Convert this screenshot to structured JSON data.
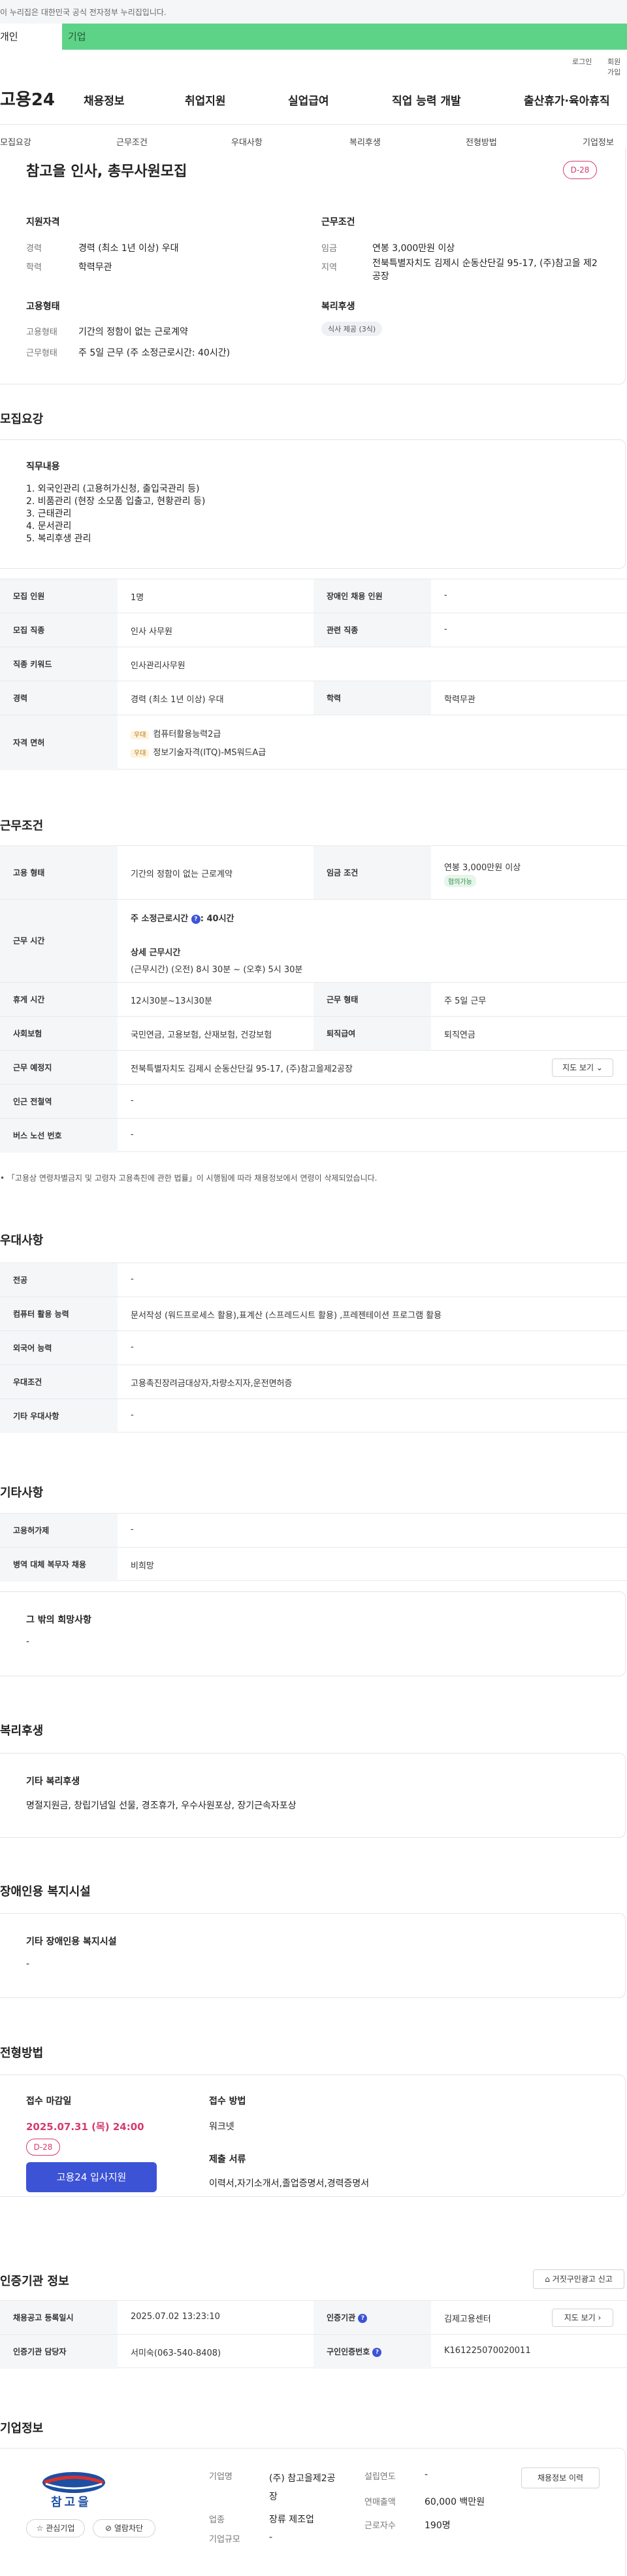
{
  "banner": "이 누리집은 대한민국 공식 전자정부 누리집입니다.",
  "tabs": {
    "individual": "개인",
    "corporate": "기업"
  },
  "util": {
    "login": "로그인",
    "signup": "회원가입"
  },
  "logo": "고용24",
  "nav": [
    "채용정보",
    "취업지원",
    "실업급여",
    "직업 능력 개발",
    "출산휴가·육아휴직"
  ],
  "subnav": [
    "모집요강",
    "근무조건",
    "우대사항",
    "복리후생",
    "전형방법",
    "기업정보"
  ],
  "summary": {
    "title": "참고을 인사, 총무사원모집",
    "dday": "D-28",
    "qual_h": "지원자격",
    "career_l": "경력",
    "career_v": "경력 (최소 1년 이상) 우대",
    "edu_l": "학력",
    "edu_v": "학력무관",
    "cond_h": "근무조건",
    "wage_l": "임금",
    "wage_v": "연봉 3,000만원 이상",
    "region_l": "지역",
    "region_v": "전북특별자치도 김제시 순동산단길 95-17, (주)참고을 제2공장",
    "type_h": "고용형태",
    "emp_l": "고용형태",
    "emp_v": "기간의 정함이 없는 근로계약",
    "work_l": "근무형태",
    "work_v": "주 5일 근무 (주 소정근로시간: 40시간)",
    "welfare_h": "복리후생",
    "welfare_chip": "식사 제공 (3식)"
  },
  "recruit": {
    "h": "모집요강",
    "duty_h": "직무내용",
    "duties": [
      "1. 외국인관리 (고용허가신청, 출입국관리 등)",
      "2. 비품관리 (현장 소모품 입출고, 현황관리 등)",
      "3. 근태관리",
      "4. 문서관리",
      "5. 복리후생 관리"
    ],
    "r1": {
      "l": "모집 인원",
      "v": "1명",
      "l2": "장애인 채용 인원",
      "v2": "-"
    },
    "r2": {
      "l": "모집 직종",
      "v": "인사 사무원",
      "l2": "관련 직종",
      "v2": "-"
    },
    "r3": {
      "l": "직종 키워드",
      "v": "인사관리사무원"
    },
    "r4": {
      "l": "경력",
      "v": "경력 (최소 1년 이상) 우대",
      "l2": "학력",
      "v2": "학력무관"
    },
    "r5": {
      "l": "자격 면허",
      "tag": "우대",
      "c1": "컴퓨터활용능력2급",
      "c2": "정보기술자격(ITQ)-MS워드A급"
    }
  },
  "cond": {
    "h": "근무조건",
    "r1": {
      "l": "고용 형태",
      "v": "기간의 정함이 없는 근로계약",
      "l2": "임금 조건",
      "v2": "연봉 3,000만원 이상",
      "badge": "협의가능"
    },
    "r2": {
      "l": "근무 시간",
      "main": "주 소정근로시간",
      "main_v": ": 40시간",
      "detail_h": "상세 근무시간",
      "detail": "(근무시간) (오전) 8시 30분 ~ (오후) 5시 30분"
    },
    "r3": {
      "l": "휴게 시간",
      "v": "12시30분~13시30분",
      "l2": "근무 형태",
      "v2": "주 5일 근무"
    },
    "r4": {
      "l": "사회보험",
      "v": "국민연금, 고용보험, 산재보험, 건강보험",
      "l2": "퇴직급여",
      "v2": "퇴직연금"
    },
    "r5": {
      "l": "근무 예정지",
      "v": "전북특별자치도 김제시 순동산단길 95-17, (주)참고을제2공장",
      "btn": "지도 보기"
    },
    "r6": {
      "l": "인근 전철역",
      "v": "-"
    },
    "r7": {
      "l": "버스 노선 번호",
      "v": "-"
    },
    "note": "「고용상 연령차별금지 및 고령자 고용촉진에 관한 법률」이 시행됨에 따라 채용정보에서 연령이 삭제되었습니다."
  },
  "pref": {
    "h": "우대사항",
    "rows": [
      {
        "l": "전공",
        "v": "-"
      },
      {
        "l": "컴퓨터 활용 능력",
        "v": "문서작성 (워드프로세스 활용),표계산 (스프레드시트 활용) ,프레젠테이션 프로그램 활용"
      },
      {
        "l": "외국어 능력",
        "v": "-"
      },
      {
        "l": "우대조건",
        "v": "고용촉진장려금대상자,차량소지자,운전면허증"
      },
      {
        "l": "기타 우대사항",
        "v": "-"
      }
    ]
  },
  "etc": {
    "h": "기타사항",
    "rows": [
      {
        "l": "고용허가제",
        "v": "-"
      },
      {
        "l": "병역 대체 복무자 채용",
        "v": "비희망"
      }
    ],
    "wish_h": "그 밖의 희망사항",
    "wish_v": "-"
  },
  "welfare": {
    "h": "복리후생",
    "sub": "기타 복리후생",
    "v": "명절지원금, 창립기념일 선물, 경조휴가, 우수사원포상, 장기근속자포상"
  },
  "disab": {
    "h": "장애인용 복지시설",
    "sub": "기타 장애인용 복지시설",
    "v": "-"
  },
  "process": {
    "h": "전형방법",
    "dl_h": "접수 마감일",
    "dl_v": "2025.07.31 (목) 24:00",
    "dday": "D-28",
    "apply": "고용24 입사지원",
    "method_h": "접수 방법",
    "method_v": "워크넷",
    "docs_h": "제출 서류",
    "docs_v": "이력서,자기소개서,졸업증명서,경력증명서"
  },
  "agency": {
    "h": "인증기관 정보",
    "report": "거짓구인광고 신고",
    "r1": {
      "l": "채용공고 등록일시",
      "v": "2025.07.02 13:23:10",
      "l2": "인증기관",
      "v2": "김제고용센터",
      "btn": "지도 보기"
    },
    "r2": {
      "l": "인증기관 담당자",
      "v": "서미숙(063-540-8408)",
      "l2": "구인인증번호",
      "v2": "K161225070020011"
    }
  },
  "company": {
    "h": "기업정보",
    "logo_text": "참고을",
    "interest": "관심기업",
    "block": "열람차단",
    "name_l": "기업명",
    "name_v": "(주) 참고을제2공장",
    "ind_l": "업종",
    "ind_v": "장류 제조업",
    "size_l": "기업규모",
    "size_v": "-",
    "est_l": "설립연도",
    "est_v": "-",
    "sales_l": "연매출액",
    "sales_v": "60,000 백만원",
    "emp_l": "근로자수",
    "emp_v": "190명",
    "hist": "채용정보 이력"
  },
  "colors": {
    "accent": "#3d53d6",
    "dday": "#d63b6b",
    "green": "#5dd388"
  }
}
